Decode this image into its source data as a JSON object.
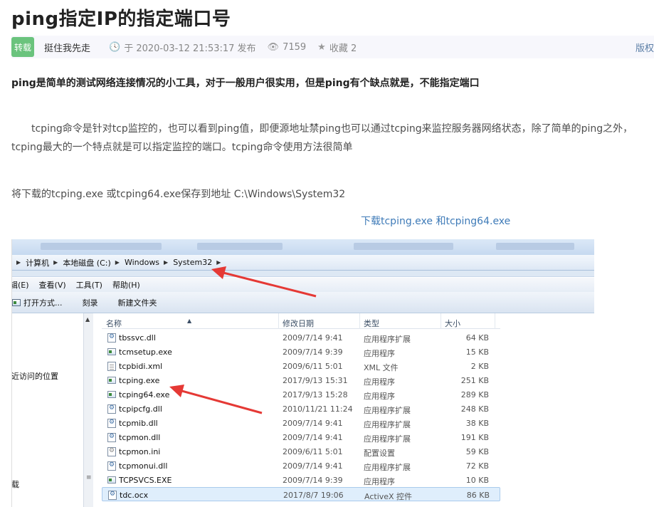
{
  "article": {
    "title": "ping指定IP的指定端口号",
    "repost_badge": "转载",
    "author": "挺住我先走",
    "publish": "于 2020-03-12 21:53:17 发布",
    "views": "7159",
    "favorites": "收藏 2",
    "copyright": "版权",
    "intro_bold": "ping是简单的测试网络连接情况的小工具，对于一般用户很实用，但是ping有个缺点就是，不能指定端口",
    "body": "tcping命令是针对tcp监控的，也可以看到ping值，即便源地址禁ping也可以通过tcping来监控服务器网络状态，除了简单的ping之外，tcping最大的一个特点就是可以指定监控的端口。tcping命令使用方法很简单",
    "save_instruction": "将下载的tcping.exe 或tcping64.exe保存到地址 C:\\Windows\\System32",
    "download_link": "下载tcping.exe 和tcping64.exe"
  },
  "explorer": {
    "breadcrumb": [
      "计算机",
      "本地磁盘 (C:)",
      "Windows",
      "System32"
    ],
    "menu": [
      "编辑(E)",
      "查看(V)",
      "工具(T)",
      "帮助(H)"
    ],
    "toolbar": [
      "打开方式...",
      "刻录",
      "新建文件夹"
    ],
    "nav_items": [
      "最近访问的位置",
      "下载"
    ],
    "columns": [
      "名称",
      "修改日期",
      "类型",
      "大小"
    ],
    "files": [
      {
        "name": "tbssvc.dll",
        "date": "2009/7/14 9:41",
        "type": "应用程序扩展",
        "size": "64 KB",
        "icon": "dll-icon"
      },
      {
        "name": "tcmsetup.exe",
        "date": "2009/7/14 9:39",
        "type": "应用程序",
        "size": "15 KB",
        "icon": "exe-icon"
      },
      {
        "name": "tcpbidi.xml",
        "date": "2009/6/11 5:01",
        "type": "XML 文件",
        "size": "2 KB",
        "icon": "xml-icon"
      },
      {
        "name": "tcping.exe",
        "date": "2017/9/13 15:31",
        "type": "应用程序",
        "size": "251 KB",
        "icon": "exe-icon"
      },
      {
        "name": "tcping64.exe",
        "date": "2017/9/13 15:28",
        "type": "应用程序",
        "size": "289 KB",
        "icon": "exe-icon"
      },
      {
        "name": "tcpipcfg.dll",
        "date": "2010/11/21 11:24",
        "type": "应用程序扩展",
        "size": "248 KB",
        "icon": "dll-icon"
      },
      {
        "name": "tcpmib.dll",
        "date": "2009/7/14 9:41",
        "type": "应用程序扩展",
        "size": "38 KB",
        "icon": "dll-icon"
      },
      {
        "name": "tcpmon.dll",
        "date": "2009/7/14 9:41",
        "type": "应用程序扩展",
        "size": "191 KB",
        "icon": "dll-icon"
      },
      {
        "name": "tcpmon.ini",
        "date": "2009/6/11 5:01",
        "type": "配置设置",
        "size": "59 KB",
        "icon": "ini-icon"
      },
      {
        "name": "tcpmonui.dll",
        "date": "2009/7/14 9:41",
        "type": "应用程序扩展",
        "size": "72 KB",
        "icon": "dll-icon"
      },
      {
        "name": "TCPSVCS.EXE",
        "date": "2009/7/14 9:39",
        "type": "应用程序",
        "size": "10 KB",
        "icon": "exe-icon"
      },
      {
        "name": "tdc.ocx",
        "date": "2017/8/7 19:06",
        "type": "ActiveX 控件",
        "size": "86 KB",
        "icon": "dll-icon"
      }
    ],
    "selected_file": "tdc.ocx",
    "annotation_color": "#e53935"
  }
}
